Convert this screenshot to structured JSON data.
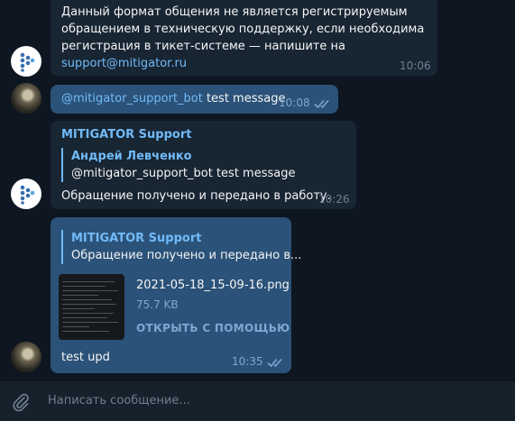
{
  "chat": {
    "messages": [
      {
        "direction": "in",
        "lines": [
          "Данный формат общения не является регистрируемым",
          "обращением в техническую поддержку, если необходима",
          "регистрация в тикет-системе — напишите на"
        ],
        "link": "support@mitigator.ru",
        "time": "10:06"
      },
      {
        "direction": "out",
        "mention": "@mitigator_support_bot",
        "text": " test message",
        "time": "10:08",
        "status": "read"
      },
      {
        "direction": "in",
        "sender": "MITIGATOR Support",
        "reply": {
          "author": "Андрей Левченко",
          "text": "@mitigator_support_bot test message"
        },
        "text": "Обращение получено и передано в работу.",
        "time": "10:26"
      },
      {
        "direction": "out",
        "reply": {
          "author": "MITIGATOR Support",
          "text": "Обращение получено и передано в..."
        },
        "file": {
          "name": "2021-05-18_15-09-16.png",
          "size": "75.7 KB",
          "open_label": "ОТКРЫТЬ С ПОМОЩЬЮ"
        },
        "text": "test upd",
        "time": "10:35",
        "status": "read"
      }
    ]
  },
  "composer": {
    "placeholder": "Написать сообщение...",
    "attach_icon": "paperclip-icon"
  },
  "icons": {
    "bot_avatar": "mitigator-logo-icon",
    "user_avatar": "user-photo-avatar",
    "read_status": "double-check-icon"
  },
  "colors": {
    "background": "#0e1621",
    "incoming_bubble": "#182533",
    "outgoing_bubble": "#2b5278",
    "accent": "#71baf8",
    "muted": "#6d7f8f",
    "composer": "#17212b"
  }
}
